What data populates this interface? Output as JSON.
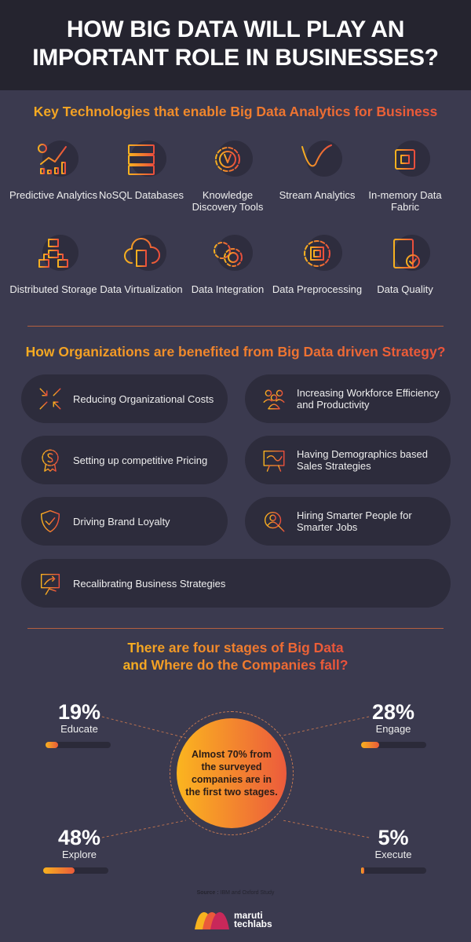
{
  "title": "HOW BIG DATA WILL PLAY AN IMPORTANT ROLE IN BUSINESSES?",
  "sections": {
    "technologies_heading": "Key Technologies that enable Big Data Analytics for Business",
    "benefits_heading": "How Organizations are benefited from Big Data driven Strategy?",
    "stages_heading": "There are four stages of Big Data and Where do the Companies fall?"
  },
  "technologies": [
    {
      "label": "Predictive Analytics",
      "icon": "chart-growth-icon"
    },
    {
      "label": "NoSQL Databases",
      "icon": "server-rack-icon"
    },
    {
      "label": "Knowledge Discovery Tools",
      "icon": "gear-wrench-icon"
    },
    {
      "label": "Stream Analytics",
      "icon": "wave-chart-icon"
    },
    {
      "label": "In-memory Data Fabric",
      "icon": "chip-icon"
    },
    {
      "label": "Distributed Storage",
      "icon": "hierarchy-icon"
    },
    {
      "label": "Data Virtualization",
      "icon": "cloud-server-icon"
    },
    {
      "label": "Data Integration",
      "icon": "gears-icon"
    },
    {
      "label": "Data Preprocessing",
      "icon": "gear-chip-icon"
    },
    {
      "label": "Data Quality",
      "icon": "server-check-icon"
    }
  ],
  "benefits": [
    {
      "label": "Reducing Organizational Costs",
      "icon": "compress-arrows-icon"
    },
    {
      "label": "Increasing Workforce Efficiency and Productivity",
      "icon": "team-icon"
    },
    {
      "label": "Setting up competitive Pricing",
      "icon": "dollar-badge-icon"
    },
    {
      "label": "Having Demographics based Sales Strategies",
      "icon": "presentation-board-icon"
    },
    {
      "label": "Driving Brand Loyalty",
      "icon": "shield-check-icon"
    },
    {
      "label": "Hiring Smarter People for Smarter Jobs",
      "icon": "user-search-icon"
    },
    {
      "label": "Recalibrating Business Strategies",
      "icon": "strategy-board-icon"
    }
  ],
  "stages": [
    {
      "pct": "19%",
      "value": 19,
      "name": "Educate"
    },
    {
      "pct": "28%",
      "value": 28,
      "name": "Engage"
    },
    {
      "pct": "48%",
      "value": 48,
      "name": "Explore"
    },
    {
      "pct": "5%",
      "value": 5,
      "name": "Execute"
    }
  ],
  "center_text": "Almost 70% from the surveyed companies are in the first two stages.",
  "source_label": "Source :",
  "source_text": "IBM and Oxford Study",
  "logo": {
    "line1": "maruti",
    "line2": "techlabs"
  },
  "colors": {
    "background": "#3b3a4f",
    "header": "#25242f",
    "accent_start": "#f7b21f",
    "accent_end": "#ea4e3c"
  }
}
